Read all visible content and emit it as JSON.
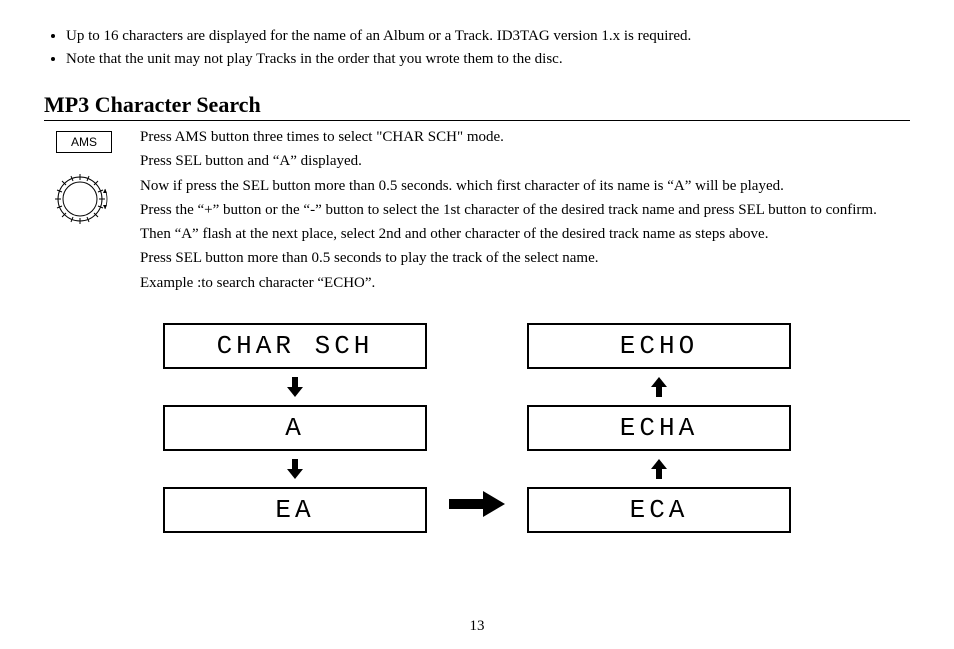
{
  "notes": [
    "Up to 16 characters are displayed for the name of an Album or a Track. ID3TAG version 1.x is required.",
    "Note that the unit may not play Tracks in the order that you wrote them to the disc."
  ],
  "section_title": "MP3 Character Search",
  "ams_label": "AMS",
  "instructions": [
    "Press AMS button three times to select \"CHAR SCH\" mode.",
    "Press SEL button and “A” displayed.",
    "Now if press the SEL button more than 0.5 seconds. which first character of its name is “A” will be played.",
    "Press the   “+” button or the “-” button to select the 1st character of the desired track name and press SEL button to confirm.",
    "Then “A” flash at the next place, select 2nd and other character of the desired track name as steps above.",
    "Press SEL button more than 0.5 seconds to play the track of the select name.",
    "Example :to search character “ECHO”."
  ],
  "diagram": {
    "left": [
      "CHAR SCH",
      "A",
      "EA"
    ],
    "right": [
      "ECHO",
      "ECHA",
      "ECA"
    ]
  },
  "page_number": "13"
}
